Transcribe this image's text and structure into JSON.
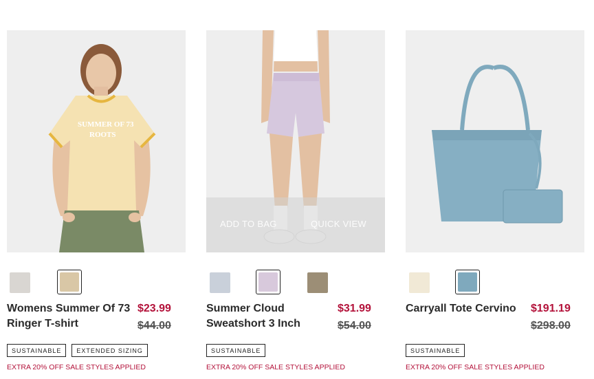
{
  "products": [
    {
      "name_line1": "Womens Summer Of 73",
      "name_line2": "Ringer T-shirt",
      "sale_price": "$23.99",
      "original_price": "$44.00",
      "swatches": [
        {
          "color": "#d9d6d2",
          "selected": false
        },
        {
          "color": "#d9c7a6",
          "selected": true
        }
      ],
      "badges": [
        "SUSTAINABLE",
        "EXTENDED SIZING"
      ],
      "promo": "EXTRA 20% OFF SALE STYLES APPLIED"
    },
    {
      "name_line1": "Summer Cloud",
      "name_line2": "Sweatshort 3 Inch",
      "sale_price": "$31.99",
      "original_price": "$54.00",
      "swatches": [
        {
          "color": "#c9d0da",
          "selected": false
        },
        {
          "color": "#d8c9dc",
          "selected": true
        },
        {
          "color": "#9c8e76",
          "selected": false
        }
      ],
      "badges": [
        "SUSTAINABLE"
      ],
      "promo": "EXTRA 20% OFF SALE STYLES APPLIED",
      "overlay": {
        "add_to_bag": "ADD TO BAG",
        "quick_view": "QUICK VIEW"
      }
    },
    {
      "name_line1": "Carryall Tote Cervino",
      "name_line2": "",
      "sale_price": "$191.19",
      "original_price": "$298.00",
      "swatches": [
        {
          "color": "#f1e9d6",
          "selected": false
        },
        {
          "color": "#7fa9bd",
          "selected": true
        }
      ],
      "badges": [
        "SUSTAINABLE"
      ],
      "promo": "EXTRA 20% OFF SALE STYLES APPLIED"
    }
  ]
}
